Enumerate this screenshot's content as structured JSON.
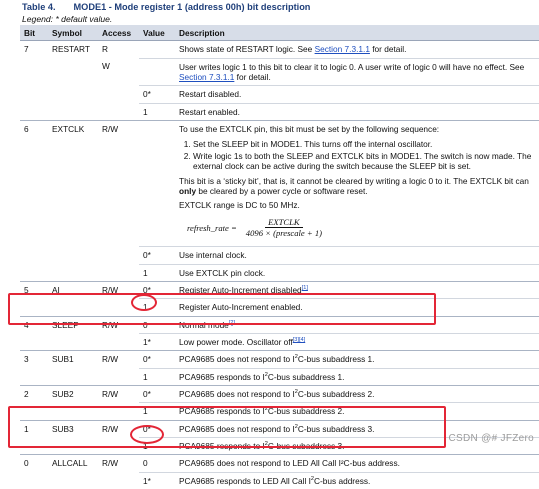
{
  "caption": {
    "number": "Table 4.",
    "title": "MODE1 - Mode register 1 (address 00h) bit description"
  },
  "legend": "Legend: * default value.",
  "headers": [
    "Bit",
    "Symbol",
    "Access",
    "Value",
    "Description"
  ],
  "restart": {
    "bit": "7",
    "symbol": "RESTART",
    "r1": {
      "access": "R",
      "desc_pre": "Shows state of RESTART logic. See ",
      "link": "Section 7.3.1.1",
      "desc_post": " for detail."
    },
    "r2": {
      "access": "W",
      "desc_pre": "User writes logic 1 to this bit to clear it to logic 0. A user write of logic 0 will have no effect. See ",
      "link": "Section 7.3.1.1",
      "desc_post": " for detail."
    },
    "r3": {
      "value": "0*",
      "desc": "Restart disabled."
    },
    "r4": {
      "value": "1",
      "desc": "Restart enabled."
    }
  },
  "extclk": {
    "bit": "6",
    "symbol": "EXTCLK",
    "access": "R/W",
    "intro": "To use the EXTCLK pin, this bit must be set by the following sequence:",
    "steps": [
      "Set the SLEEP bit in MODE1. This turns off the internal oscillator.",
      "Write logic 1s to both the SLEEP and EXTCLK bits in MODE1. The switch is now made. The external clock can be active during the switch because the SLEEP bit is set."
    ],
    "sticky_pre": "This bit is a ‘sticky bit’, that is, it cannot be cleared by writing a logic 0 to it. The EXTCLK bit can ",
    "sticky_bold": "only",
    "sticky_post": " be cleared by a power cycle or software reset.",
    "range": "EXTCLK range is DC to 50 MHz.",
    "formula": {
      "lhs": "refresh_rate =",
      "numerator": "EXTCLK",
      "denominator": "4096 × (prescale + 1)"
    },
    "r2": {
      "value": "0*",
      "desc": "Use internal clock."
    },
    "r3": {
      "value": "1",
      "desc": "Use EXTCLK pin clock."
    }
  },
  "ai": {
    "bit": "5",
    "symbol": "AI",
    "access": "R/W",
    "r1": {
      "value": "0*",
      "desc": "Register Auto-Increment disabled",
      "note": "[1]"
    },
    "r2": {
      "value": "1",
      "desc": "Register Auto-Increment enabled."
    }
  },
  "sleep": {
    "bit": "4",
    "symbol": "SLEEP",
    "access": "R/W",
    "r1": {
      "value": "0",
      "desc": "Normal mode",
      "note": "[2]"
    },
    "r2": {
      "value": "1*",
      "desc": "Low power mode. Oscillator off",
      "notes": [
        "[3]",
        "[4]"
      ]
    }
  },
  "sub1": {
    "bit": "3",
    "symbol": "SUB1",
    "access": "R/W",
    "r1": {
      "value": "0*",
      "pre": "PCA9685 does not respond to I",
      "post": "C-bus subaddress 1."
    },
    "r2": {
      "value": "1",
      "pre": "PCA9685 responds to I",
      "post": "C-bus subaddress 1."
    }
  },
  "sub2": {
    "bit": "2",
    "symbol": "SUB2",
    "access": "R/W",
    "r1": {
      "value": "0*",
      "pre": "PCA9685 does not respond to I",
      "post": "C-bus subaddress 2."
    },
    "r2": {
      "value": "1",
      "pre": "PCA9685 responds to I",
      "post": "C-bus subaddress 2."
    }
  },
  "sub3": {
    "bit": "1",
    "symbol": "SUB3",
    "access": "R/W",
    "r1": {
      "value": "0*",
      "pre": "PCA9685 does not respond to I",
      "post": "C-bus subaddress 3."
    },
    "r2": {
      "value": "1",
      "pre": "PCA9685 responds to I",
      "post": "C-bus subaddress 3."
    }
  },
  "allcall": {
    "bit": "0",
    "symbol": "ALLCALL",
    "access": "R/W",
    "r1": {
      "value": "0",
      "desc": "PCA9685 does not respond to LED All Call I²C-bus address."
    },
    "r2": {
      "value": "1*",
      "pre": "PCA9685 responds to LED All Call I",
      "post": "C-bus address."
    }
  },
  "i2c_sup": "2",
  "annotation_color": "#e32636",
  "watermark": "CSDN @# JFZero"
}
